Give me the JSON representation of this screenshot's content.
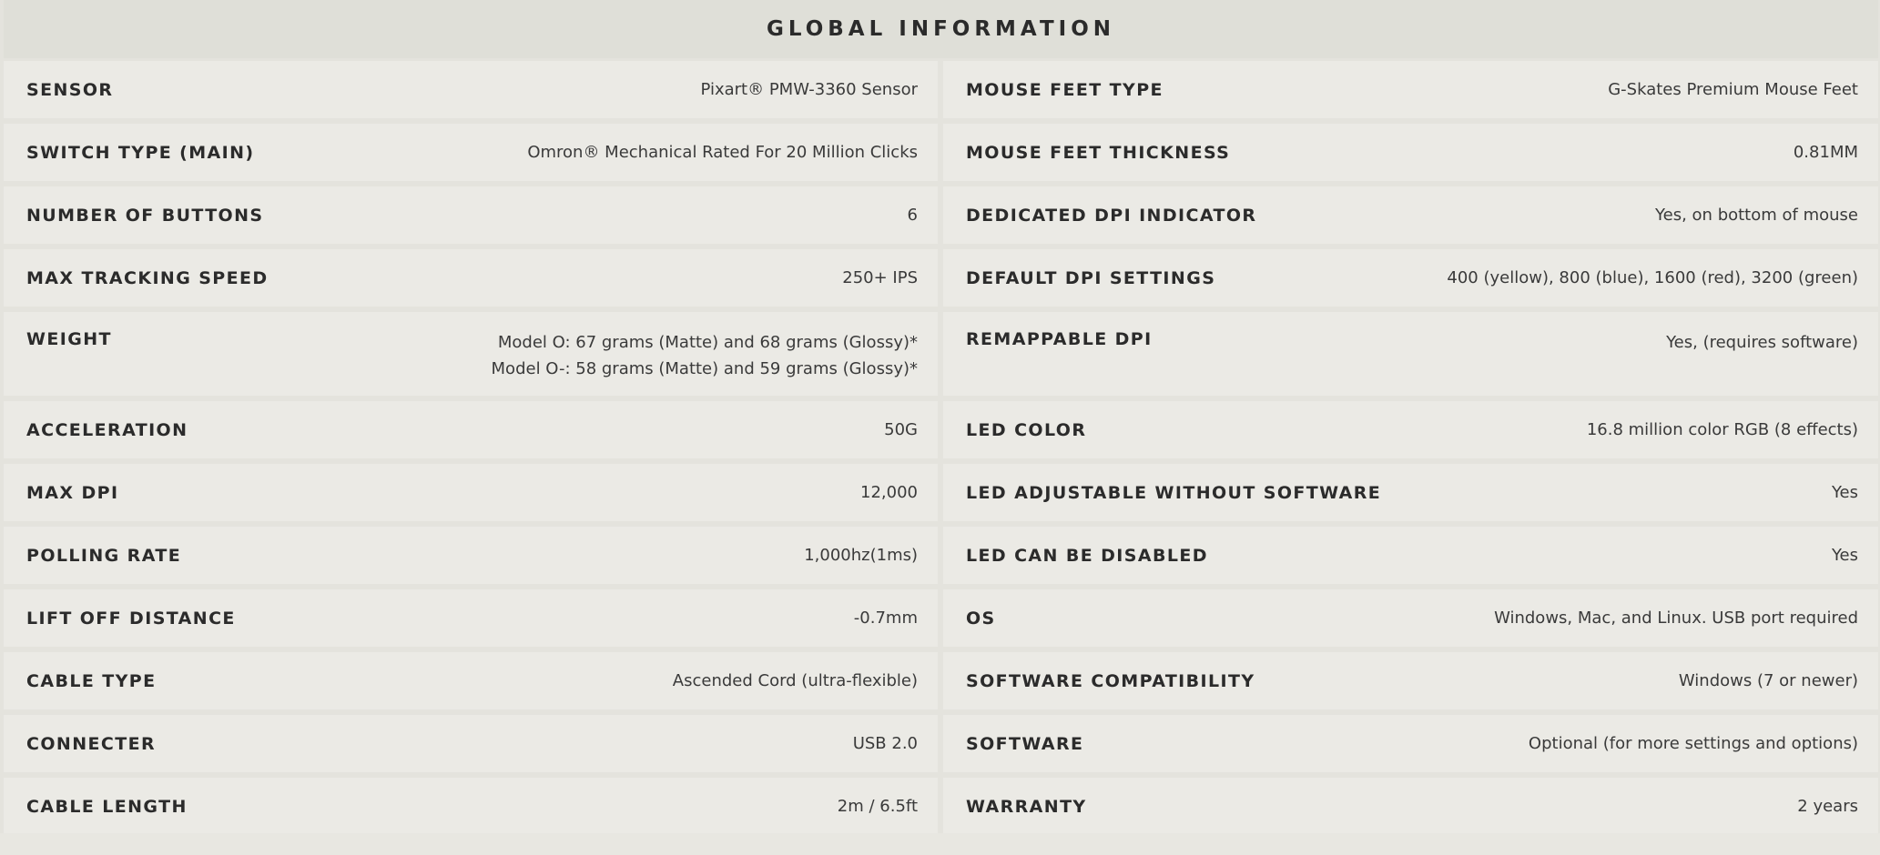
{
  "header": {
    "title": "GLOBAL INFORMATION"
  },
  "rows": [
    {
      "left": {
        "label": "SENSOR",
        "value": "Pixart® PMW-3360 Sensor"
      },
      "right": {
        "label": "MOUSE FEET TYPE",
        "value": "G-Skates Premium Mouse Feet"
      }
    },
    {
      "left": {
        "label": "SWITCH TYPE (MAIN)",
        "value": "Omron® Mechanical Rated For 20 Million Clicks"
      },
      "right": {
        "label": "MOUSE FEET THICKNESS",
        "value": "0.81MM"
      }
    },
    {
      "left": {
        "label": "NUMBER OF BUTTONS",
        "value": "6"
      },
      "right": {
        "label": "DEDICATED DPI INDICATOR",
        "value": "Yes, on bottom of mouse"
      }
    },
    {
      "left": {
        "label": "MAX TRACKING SPEED",
        "value": "250+ IPS"
      },
      "right": {
        "label": "DEFAULT DPI SETTINGS",
        "value": "400 (yellow), 800 (blue), 1600 (red), 3200 (green)"
      }
    },
    {
      "left": {
        "label": "WEIGHT",
        "value_line1": "Model O: 67 grams (Matte) and 68 grams (Glossy)*",
        "value_line2": "Model O-: 58 grams (Matte) and 59 grams (Glossy)*"
      },
      "right": {
        "label": "REMAPPABLE DPI",
        "value": "Yes, (requires software)"
      }
    },
    {
      "left": {
        "label": "ACCELERATION",
        "value": "50G"
      },
      "right": {
        "label": "LED COLOR",
        "value": "16.8 million color RGB (8 effects)"
      }
    },
    {
      "left": {
        "label": "MAX DPI",
        "value": "12,000"
      },
      "right": {
        "label": "LED ADJUSTABLE WITHOUT SOFTWARE",
        "value": "Yes"
      }
    },
    {
      "left": {
        "label": "POLLING RATE",
        "value": "1,000hz(1ms)"
      },
      "right": {
        "label": "LED CAN BE DISABLED",
        "value": "Yes"
      }
    },
    {
      "left": {
        "label": "LIFT OFF DISTANCE",
        "value": "-0.7mm"
      },
      "right": {
        "label": "OS",
        "value": "Windows, Mac, and Linux. USB port required"
      }
    },
    {
      "left": {
        "label": "CABLE TYPE",
        "value": "Ascended Cord (ultra-flexible)"
      },
      "right": {
        "label": "SOFTWARE COMPATIBILITY",
        "value": "Windows (7 or newer)"
      }
    },
    {
      "left": {
        "label": "CONNECTER",
        "value": "USB 2.0"
      },
      "right": {
        "label": "SOFTWARE",
        "value": "Optional (for more settings and options)"
      }
    },
    {
      "left": {
        "label": "CABLE LENGTH",
        "value": "2m / 6.5ft"
      },
      "right": {
        "label": "WARRANTY",
        "value": "2 years"
      }
    }
  ]
}
